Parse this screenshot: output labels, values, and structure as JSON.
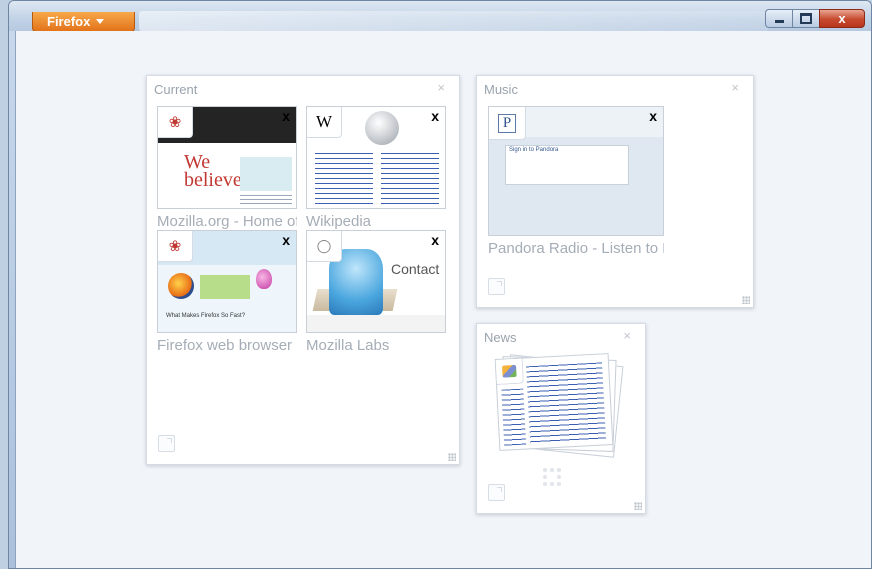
{
  "app": {
    "menu_label": "Firefox"
  },
  "window_controls": {
    "minimize": "minimize",
    "maximize": "maximize",
    "close": "x"
  },
  "groups": [
    {
      "title": "Current",
      "close": "×",
      "tabs": [
        {
          "title": "Mozilla.org - Home of the Mozilla Project",
          "favicon": "mozilla-dino-icon",
          "close": "x",
          "page_text": "We believe",
          "favicon_color": "#c13832"
        },
        {
          "title": "Wikipedia",
          "favicon": "wikipedia-icon",
          "favicon_text": "W",
          "close": "x"
        },
        {
          "title": "Firefox web browser",
          "favicon": "mozilla-dino-icon",
          "close": "x",
          "page_text": "What Makes Firefox So Fast?"
        },
        {
          "title": "Mozilla Labs",
          "favicon": "labs-icon",
          "close": "x",
          "page_text": "Contact"
        }
      ]
    },
    {
      "title": "Music",
      "close": "×",
      "tabs": [
        {
          "title": "Pandora Radio - Listen to Free Internet Radio",
          "favicon": "pandora-icon",
          "favicon_text": "P",
          "close": "x",
          "page_text": "Sign in to Pandora"
        }
      ]
    },
    {
      "title": "News",
      "close": "×",
      "tabs": [
        {
          "title": "",
          "favicon": "news-icon"
        }
      ]
    }
  ],
  "colors": {
    "firefox_button": "#e2731a",
    "close_button": "#c74a2f",
    "background": "#f1f5fa"
  }
}
